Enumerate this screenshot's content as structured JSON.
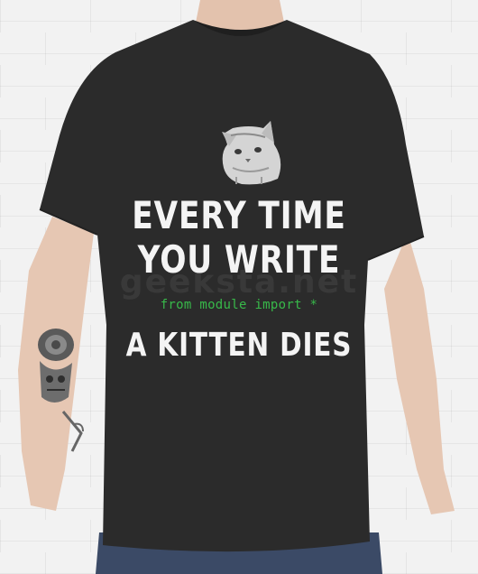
{
  "shirt_print": {
    "line1": "EVERY TIME",
    "line2": "YOU WRITE",
    "code": "from module import *",
    "line3": "A KITTEN DIES",
    "watermark": "geeksta.net"
  },
  "colors": {
    "background": "#f1f1f1",
    "shirt": "#2b2b2b",
    "print_text": "#f4f4f4",
    "code_text": "#38b94a",
    "jeans": "#3b4a66"
  },
  "icons": {
    "kitten": "kitten-illustration",
    "tattoo": "rose-skull-tattoo"
  }
}
